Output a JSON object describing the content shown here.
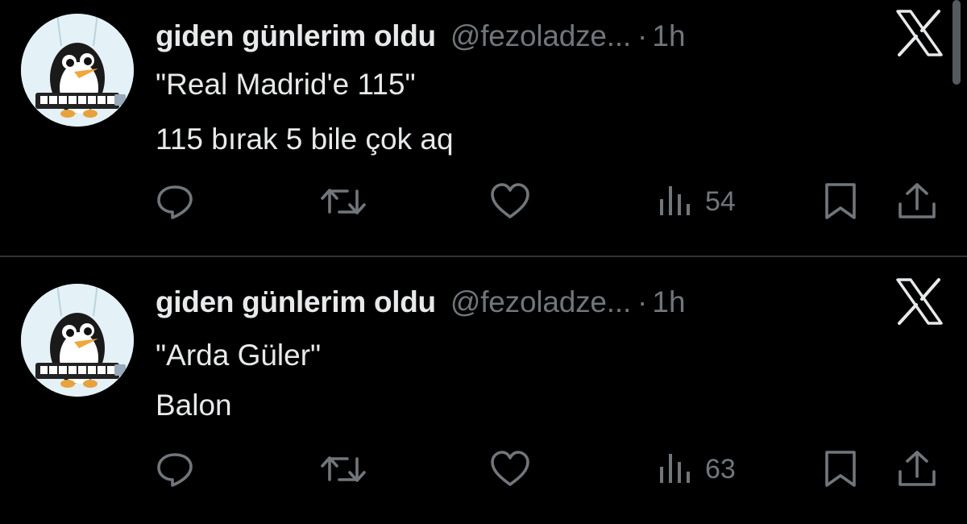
{
  "tweets": [
    {
      "author": {
        "display_name": "giden günlerim oldu",
        "handle": "@fezoladze...",
        "avatar_icon": "penguin-keyboard-avatar"
      },
      "separator": "·",
      "time": "1h",
      "text_lines": [
        "\"Real Madrid'e 115\"",
        "115 bırak 5 bile çok aq"
      ],
      "stats": {
        "views": "54"
      }
    },
    {
      "author": {
        "display_name": "giden günlerim oldu",
        "handle": "@fezoladze...",
        "avatar_icon": "penguin-keyboard-avatar"
      },
      "separator": "·",
      "time": "1h",
      "text_lines": [
        "\"Arda Güler\"",
        "Balon"
      ],
      "stats": {
        "views": "63"
      }
    }
  ],
  "icons": {
    "brand": "x-logo-icon",
    "reply": "reply-icon",
    "retweet": "retweet-icon",
    "like": "heart-icon",
    "views": "views-icon",
    "bookmark": "bookmark-icon",
    "share": "share-icon"
  },
  "colors": {
    "background": "#000000",
    "primary_text": "#e7e9ea",
    "secondary_text": "#71767b",
    "divider": "#2f3336"
  }
}
